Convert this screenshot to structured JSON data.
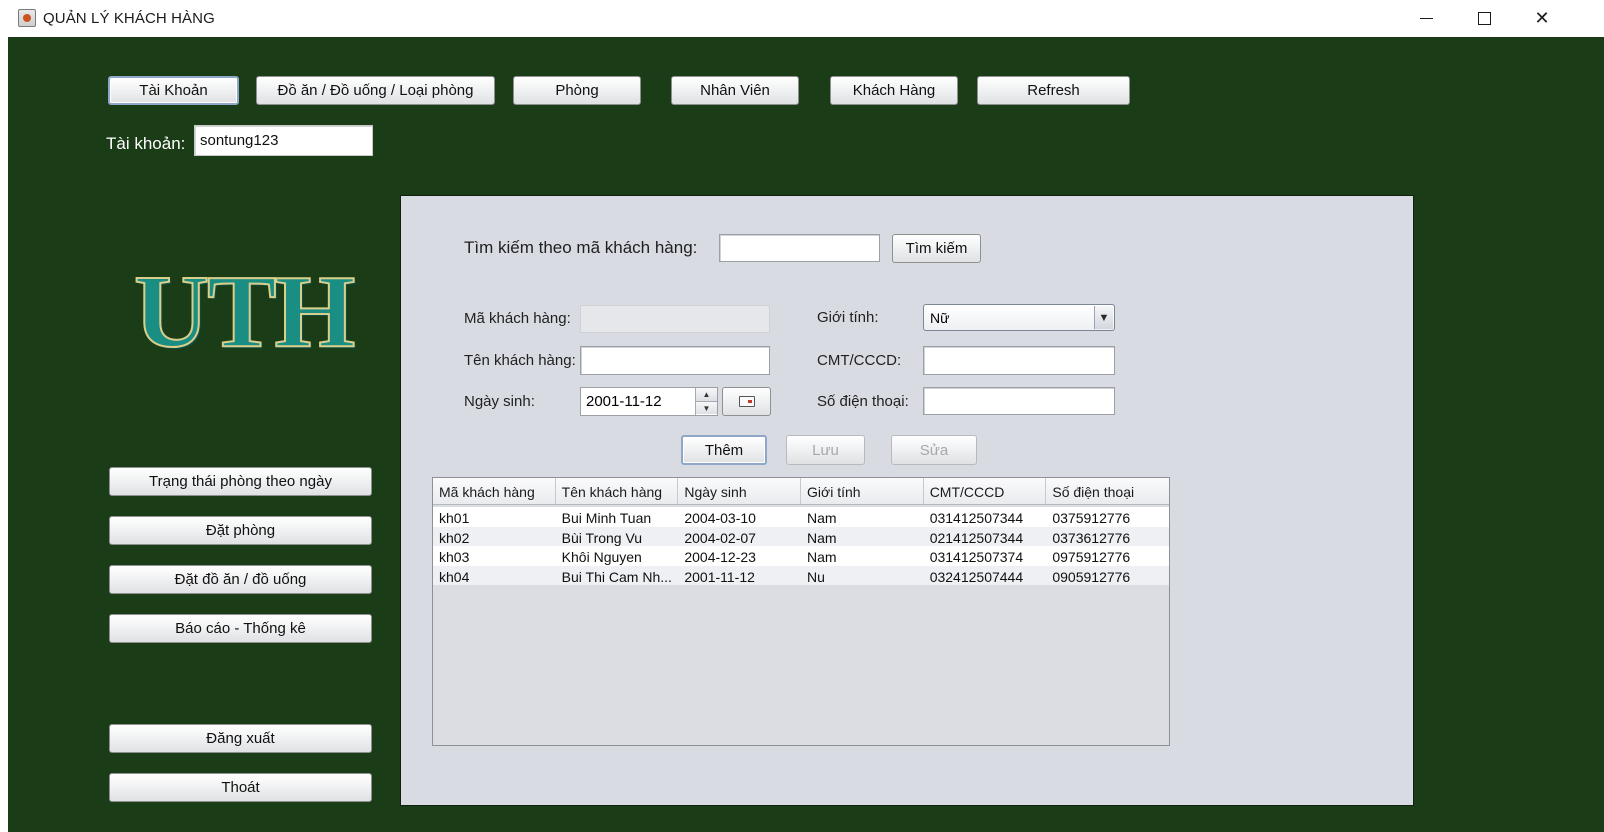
{
  "window": {
    "title": "QUẢN LÝ KHÁCH HÀNG"
  },
  "topnav": [
    "Tài Khoản",
    "Đồ ăn / Đồ uống / Loại phòng",
    "Phòng",
    "Nhân Viên",
    "Khách Hàng",
    "Refresh"
  ],
  "account": {
    "label": "Tài khoản:",
    "value": "sontung123"
  },
  "logo": {
    "text": "UTH"
  },
  "sidebar": {
    "items": [
      "Trạng thái phòng theo ngày",
      "Đặt phòng",
      "Đặt đồ ăn / đồ uống",
      "Báo cáo - Thống kê"
    ],
    "logout": "Đăng xuất",
    "exit": "Thoát"
  },
  "search": {
    "label": "Tìm kiếm theo mã khách hàng:",
    "value": "",
    "button": "Tìm kiếm"
  },
  "form": {
    "customer_id_label": "Mã khách hàng:",
    "customer_id_value": "",
    "name_label": "Tên khách hàng:",
    "name_value": "",
    "dob_label": "Ngày sinh:",
    "dob_value": "2001-11-12",
    "gender_label": "Giới tính:",
    "gender_value": "Nữ",
    "id_card_label": "CMT/CCCD:",
    "id_card_value": "",
    "phone_label": "Số điện thoại:",
    "phone_value": ""
  },
  "actions": {
    "add": "Thêm",
    "save": "Lưu",
    "edit": "Sửa"
  },
  "table": {
    "columns": [
      "Mã khách hàng",
      "Tên khách hàng",
      "Ngày sinh",
      "Giới tính",
      "CMT/CCCD",
      "Số điện thoại"
    ],
    "rows": [
      [
        "kh01",
        "Bui Minh Tuan",
        "2004-03-10",
        "Nam",
        "031412507344",
        "0375912776"
      ],
      [
        "kh02",
        "Bùi Trong Vu",
        "2004-02-07",
        "Nam",
        "021412507344",
        "0373612776"
      ],
      [
        "kh03",
        "Khôi Nguyen",
        "2004-12-23",
        "Nam",
        "031412507374",
        "0975912776"
      ],
      [
        "kh04",
        "Bui Thi Cam Nh...",
        "2001-11-12",
        "Nu",
        "032412507444",
        "0905912776"
      ]
    ]
  }
}
